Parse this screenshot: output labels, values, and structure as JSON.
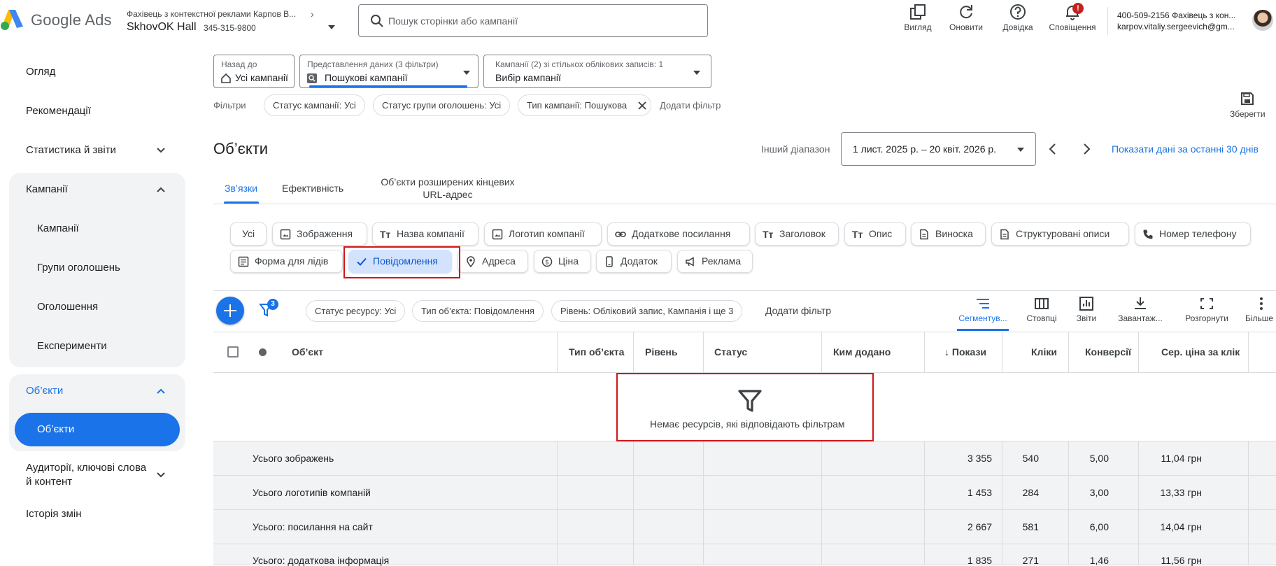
{
  "app": {
    "logo_text": "Google Ads",
    "account_top": "Фахівець з контекстної реклами Карпов В...",
    "account_name": "SkhovOK Hall",
    "account_id": "345-315-9800",
    "search_placeholder": "Пошук сторінки або кампанії",
    "tools": [
      {
        "label": "Вигляд",
        "icon": "appearance-icon"
      },
      {
        "label": "Оновити",
        "icon": "refresh-icon"
      },
      {
        "label": "Довідка",
        "icon": "help-icon"
      },
      {
        "label": "Сповіщення",
        "icon": "bell-icon",
        "badge": "!"
      }
    ],
    "user_line1": "400-509-2156 Фахівець з кон...",
    "user_line2": "karpov.vitaliy.sergeevich@gm..."
  },
  "sidebar": {
    "items": {
      "overview": "Огляд",
      "recommendations": "Рекомендації",
      "stats": "Статистика й звіти",
      "campaigns_group": "Кампанії",
      "campaigns": "Кампанії",
      "ad_groups": "Групи оголошень",
      "ads": "Оголошення",
      "experiments": "Експерименти",
      "assets_group": "Об’єкти",
      "assets": "Об’єкти",
      "audiences_line1": "Аудиторії, ключові слова",
      "audiences_line2": "й контент",
      "change_history": "Історія змін"
    }
  },
  "selectors": {
    "back": {
      "label": "Назад до",
      "value": "Усі кампанії"
    },
    "view": {
      "label": "Представлення даних (3 фільтри)",
      "value": "Пошукові кампанії"
    },
    "campaigns": {
      "label": "Кампанії (2) зі стількох облікових записів: 1",
      "value": "Вибір кампанії"
    }
  },
  "filters": {
    "label": "Фільтри",
    "chips": [
      "Статус кампанії: Усі",
      "Статус групи оголошень: Усі",
      "Тип кампанії: Пошукова"
    ],
    "add": "Додати фільтр",
    "save": "Зберегти"
  },
  "page": {
    "title": "Об’єкти",
    "range_label": "Інший діапазон",
    "range_value": "1 лист. 2025 р. – 20 квіт. 2026 р.",
    "last30": "Показати дані за останні 30 днів"
  },
  "tabs": {
    "links": "Зв’язки",
    "performance": "Ефективність",
    "final_url_1": "Об’єкти розширених кінцевих",
    "final_url_2": "URL-адрес"
  },
  "asset_types": {
    "all": "Усі",
    "images": "Зображення",
    "business_name": "Назва компанії",
    "logo": "Логотип компанії",
    "sitelink": "Додаткове посилання",
    "headline": "Заголовок",
    "description": "Опис",
    "callout": "Виноска",
    "structured": "Структуровані описи",
    "phone": "Номер телефону",
    "lead_form": "Форма для лідів",
    "message": "Повідомлення",
    "location": "Адреса",
    "price": "Ціна",
    "app": "Додаток",
    "promotion": "Реклама"
  },
  "table_toolbar": {
    "filter_count": "3",
    "chips": [
      "Статус ресурсу: Усі",
      "Тип об’єкта: Повідомлення",
      "Рівень: Обліковий запис, Кампанія і ще 3"
    ],
    "add_filter": "Додати фільтр",
    "tools": {
      "segment": "Сегментув...",
      "columns": "Стовпці",
      "reports": "Звіти",
      "download": "Завантаж...",
      "expand": "Розгорнути",
      "more": "Більше"
    }
  },
  "table": {
    "headers": {
      "asset": "Об’єкт",
      "type": "Тип об’єкта",
      "level": "Рівень",
      "status": "Статус",
      "added_by": "Ким додано",
      "impressions": "Покази",
      "clicks": "Кліки",
      "conversions": "Конверсії",
      "avg_cpc": "Сер. ціна за клік"
    },
    "empty_message": "Немає ресурсів, які відповідають фільтрам",
    "rows": [
      {
        "name": "Усього зображень",
        "impressions": "3 355",
        "clicks": "540",
        "conversions": "5,00",
        "avg_cpc": "11,04 грн"
      },
      {
        "name": "Усього логотипів компаній",
        "impressions": "1 453",
        "clicks": "284",
        "conversions": "3,00",
        "avg_cpc": "13,33 грн"
      },
      {
        "name": "Усього: посилання на сайт",
        "impressions": "2 667",
        "clicks": "581",
        "conversions": "6,00",
        "avg_cpc": "14,04 грн"
      },
      {
        "name": "Усього: додаткова інформація",
        "impressions": "1 835",
        "clicks": "271",
        "conversions": "1,46",
        "avg_cpc": "11,56 грн"
      }
    ]
  },
  "colors": {
    "accent": "#1a73e8",
    "selected_chip": "#d3e3fd",
    "highlight": "#d01616"
  }
}
